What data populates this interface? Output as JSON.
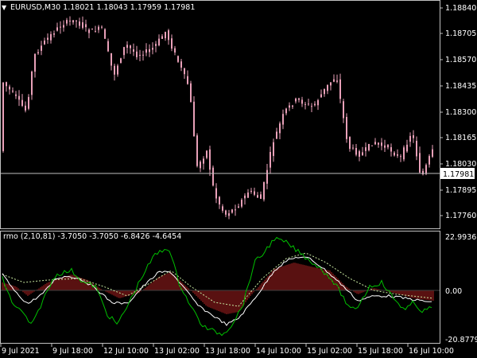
{
  "main_chart": {
    "title": "EURUSD,M30  1.18021 1.18043 1.17959 1.17981",
    "price_axis": [
      "1.18840",
      "1.18705",
      "1.18570",
      "1.18435",
      "1.18300",
      "1.18165",
      "1.18030",
      "1.17895",
      "1.17760"
    ],
    "current_price": "1.17981",
    "candle_color": "#e8a0b8",
    "bid_line_color": "#c0c0c0"
  },
  "indicator": {
    "label": "rmo (2,10,81) -3.7050 -3.7050 -6.8426 -4.6454",
    "scale": [
      "22.9936",
      "0.00",
      "-20.8779"
    ],
    "histogram_color": "#b22222",
    "fast_line_color": "#00c000",
    "slow_line_color": "#ffffff",
    "signal_line_color": "#c8e8a0"
  },
  "time_axis": [
    "9 Jul 2021",
    "9 Jul 18:00",
    "12 Jul 10:00",
    "13 Jul 02:00",
    "13 Jul 18:00",
    "14 Jul 10:00",
    "15 Jul 02:00",
    "15 Jul 18:00",
    "16 Jul 10:00"
  ]
}
